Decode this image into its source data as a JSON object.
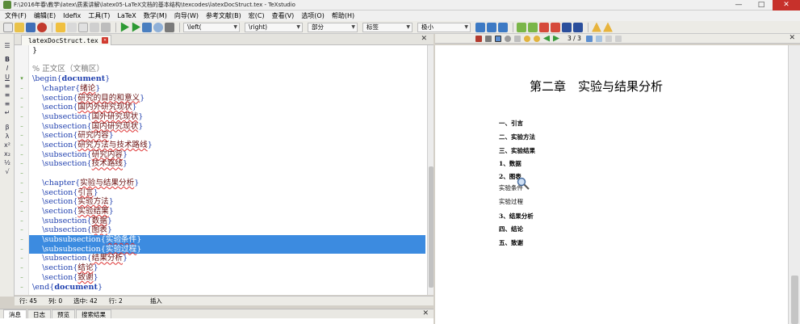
{
  "window": {
    "title": "F:\\2016年春\\教学\\latex\\质素讲解\\latex05-LaTeX文档的基本结构\\texcodes\\latexDocStruct.tex - TeXstudio"
  },
  "menu": [
    "文件(F)",
    "编辑(E)",
    "Idefix",
    "工具(T)",
    "LaTeX",
    "数学(M)",
    "向导(W)",
    "参考文献(B)",
    "宏(C)",
    "查看(V)",
    "选项(O)",
    "帮助(H)"
  ],
  "toolbar": {
    "left_combo": "\\left(",
    "right_combo": "\\right)",
    "section_combo": "部分",
    "label_combo": "标签",
    "size_combo": "极小"
  },
  "editor": {
    "tab_name": "latexDocStruct.tex",
    "lines": [
      [
        {
          "t": "}",
          "c": "plain"
        }
      ],
      [],
      [
        {
          "t": "% 正文区（文稿区）",
          "c": "comment"
        }
      ],
      [
        {
          "t": "\\begin{",
          "c": "cmd"
        },
        {
          "t": "document",
          "c": "env"
        },
        {
          "t": "}",
          "c": "cmd"
        }
      ],
      [
        {
          "t": "    \\chapter{",
          "c": "cmd"
        },
        {
          "t": "绪论",
          "c": "arg"
        },
        {
          "t": "}",
          "c": "cmd"
        }
      ],
      [
        {
          "t": "    \\section{",
          "c": "cmd"
        },
        {
          "t": "研究的目的和意义",
          "c": "arg"
        },
        {
          "t": "}",
          "c": "cmd"
        }
      ],
      [
        {
          "t": "    \\section{",
          "c": "cmd"
        },
        {
          "t": "国内外研究现状",
          "c": "arg"
        },
        {
          "t": "}",
          "c": "cmd"
        }
      ],
      [
        {
          "t": "    \\subsection{",
          "c": "cmd"
        },
        {
          "t": "国外研究现状",
          "c": "arg"
        },
        {
          "t": "}",
          "c": "cmd"
        }
      ],
      [
        {
          "t": "    \\subsection{",
          "c": "cmd"
        },
        {
          "t": "国内研究现状",
          "c": "arg"
        },
        {
          "t": "}",
          "c": "cmd"
        }
      ],
      [
        {
          "t": "    \\section{",
          "c": "cmd"
        },
        {
          "t": "研究内容",
          "c": "arg"
        },
        {
          "t": "}",
          "c": "cmd"
        }
      ],
      [
        {
          "t": "    \\section{",
          "c": "cmd"
        },
        {
          "t": "研究方法与技术路线",
          "c": "arg"
        },
        {
          "t": "}",
          "c": "cmd"
        }
      ],
      [
        {
          "t": "    \\subsection{",
          "c": "cmd"
        },
        {
          "t": "研究内容",
          "c": "arg"
        },
        {
          "t": "}",
          "c": "cmd"
        }
      ],
      [
        {
          "t": "    \\subsection{",
          "c": "cmd"
        },
        {
          "t": "技术路线",
          "c": "arg"
        },
        {
          "t": "}",
          "c": "cmd"
        }
      ],
      [],
      [
        {
          "t": "    \\chapter{",
          "c": "cmd"
        },
        {
          "t": "实验与结果分析",
          "c": "arg"
        },
        {
          "t": "}",
          "c": "cmd"
        }
      ],
      [
        {
          "t": "    \\section{",
          "c": "cmd"
        },
        {
          "t": "引言",
          "c": "arg"
        },
        {
          "t": "}",
          "c": "cmd"
        }
      ],
      [
        {
          "t": "    \\section{",
          "c": "cmd"
        },
        {
          "t": "实验方法",
          "c": "arg"
        },
        {
          "t": "}",
          "c": "cmd"
        }
      ],
      [
        {
          "t": "    \\section{",
          "c": "cmd"
        },
        {
          "t": "实验结果",
          "c": "arg"
        },
        {
          "t": "}",
          "c": "cmd"
        }
      ],
      [
        {
          "t": "    \\subsection{",
          "c": "cmd"
        },
        {
          "t": "数据",
          "c": "arg"
        },
        {
          "t": "}",
          "c": "cmd"
        }
      ],
      [
        {
          "t": "    \\subsection{",
          "c": "cmd"
        },
        {
          "t": "图表",
          "c": "arg"
        },
        {
          "t": "}",
          "c": "cmd"
        }
      ],
      [
        {
          "t": "    \\subsubsection{",
          "c": "cmd"
        },
        {
          "t": "实验条件",
          "c": "arg"
        },
        {
          "t": "}",
          "c": "cmd"
        }
      ],
      [
        {
          "t": "    \\subsubsection{",
          "c": "cmd"
        },
        {
          "t": "实验过程",
          "c": "arg"
        },
        {
          "t": "}",
          "c": "cmd"
        }
      ],
      [
        {
          "t": "    \\subsection{",
          "c": "cmd"
        },
        {
          "t": "结果分析",
          "c": "arg"
        },
        {
          "t": "}",
          "c": "cmd"
        }
      ],
      [
        {
          "t": "    \\section{",
          "c": "cmd"
        },
        {
          "t": "结论",
          "c": "arg"
        },
        {
          "t": "}",
          "c": "cmd"
        }
      ],
      [
        {
          "t": "    \\section{",
          "c": "cmd"
        },
        {
          "t": "致谢",
          "c": "arg"
        },
        {
          "t": "}",
          "c": "cmd"
        }
      ],
      [
        {
          "t": "\\end{",
          "c": "cmd"
        },
        {
          "t": "document",
          "c": "env"
        },
        {
          "t": "}",
          "c": "cmd"
        }
      ]
    ],
    "selected_lines": [
      20,
      21
    ]
  },
  "status": {
    "line": "行: 45",
    "col": "列: 0",
    "selected": "选中: 42",
    "lines": "行: 2",
    "mode": "插入"
  },
  "bottom_tabs": [
    "消息",
    "日志",
    "预览",
    "搜索结果"
  ],
  "pdf": {
    "page_label": "3 / 3",
    "chapter_title": "第二章　实验与结果分析",
    "entries": [
      {
        "text": "一、引言",
        "bold": true
      },
      {
        "text": "二、实验方法",
        "bold": true
      },
      {
        "text": "三、实验结果",
        "bold": true
      },
      {
        "text": "1、数据",
        "bold": true
      },
      {
        "text": "2、图表",
        "bold": true
      },
      {
        "text": "实验条件",
        "bold": false
      },
      {
        "text": "实验过程",
        "bold": false
      },
      {
        "text": "3、结果分析",
        "bold": true
      },
      {
        "text": "四、结论",
        "bold": true
      },
      {
        "text": "五、致谢",
        "bold": true
      }
    ]
  }
}
